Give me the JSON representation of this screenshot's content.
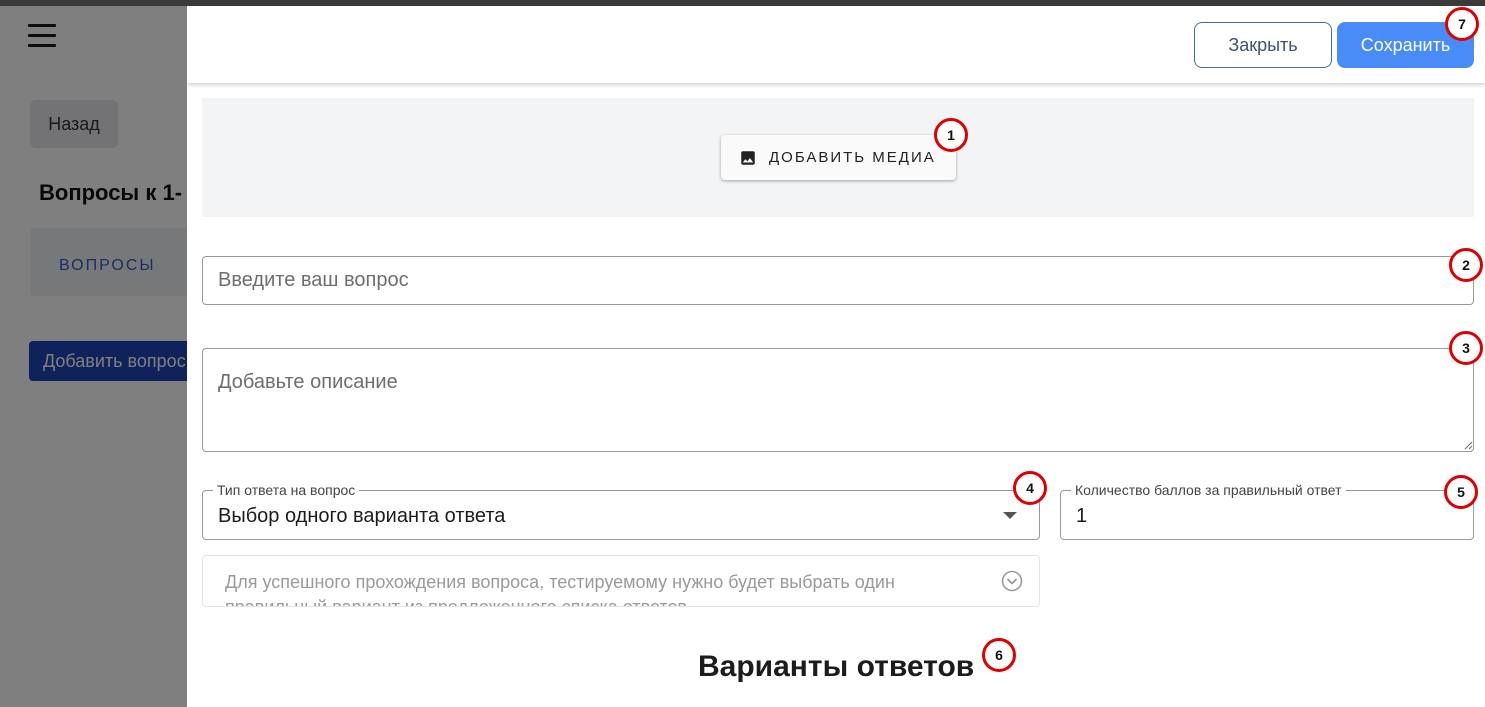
{
  "background": {
    "back_label": "Назад",
    "heading": "Вопросы к 1-",
    "tab_questions": "ВОПРОСЫ",
    "add_question_label": "Добавить вопрос"
  },
  "modal": {
    "close_label": "Закрыть",
    "save_label": "Сохранить",
    "media_button_label": "ДОБАВИТЬ МЕДИА",
    "question_placeholder": "Введите ваш вопрос",
    "description_placeholder": "Добавьте описание",
    "answer_type": {
      "label": "Тип ответа на вопрос",
      "value": "Выбор одного варианта ответа"
    },
    "points": {
      "label": "Количество баллов за правильный ответ",
      "value": "1"
    },
    "hint_text": "Для успешного прохождения вопроса, тестируемому нужно будет выбрать один правильный вариант из предложенного списка ответов",
    "answers_title": "Варианты ответов"
  },
  "badges": [
    "1",
    "2",
    "3",
    "4",
    "5",
    "6",
    "7"
  ],
  "colors": {
    "save_button": "#4a8cf7",
    "badge_border": "#e00000",
    "add_question_button": "#1e45b8"
  },
  "icons": [
    "hamburger-menu-icon",
    "image-icon",
    "caret-down-icon",
    "chevron-circle-down-icon"
  ]
}
